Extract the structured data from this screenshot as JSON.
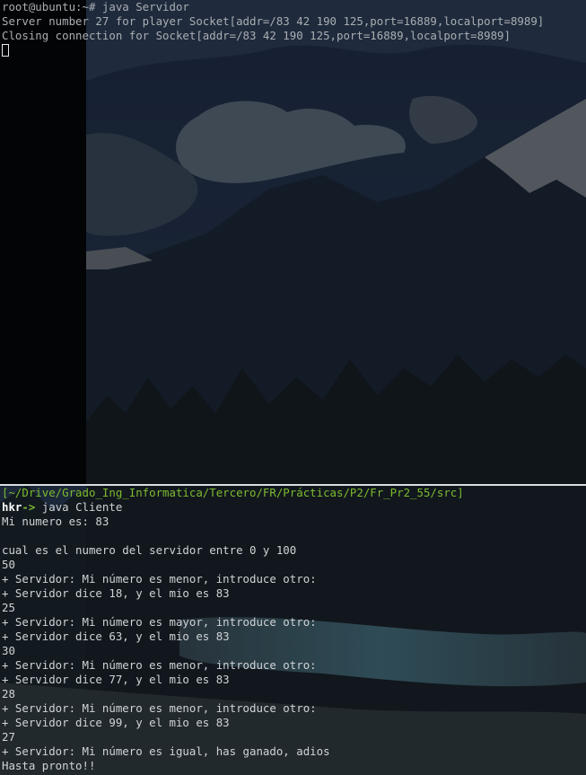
{
  "top_terminal": {
    "lines": [
      "root@ubuntu:~# java Servidor",
      "Server number 27 for player Socket[addr=/83 42 190 125,port=16889,localport=8989]",
      "Closing connection for Socket[addr=/83 42 190 125,port=16889,localport=8989]"
    ]
  },
  "bottom_terminal": {
    "path": "[~/Drive/Grado_Ing_Informatica/Tercero/FR/Prácticas/P2/Fr_Pr2_55/src]",
    "prompt_user": "hkr",
    "prompt_arrow": "->",
    "command": " java Cliente",
    "lines": [
      "Mi numero es: 83",
      "",
      "cual es el numero del servidor entre 0 y 100",
      "50",
      "+ Servidor: Mi número es menor, introduce otro:",
      "+ Servidor dice 18, y el mio es 83",
      "25",
      "+ Servidor: Mi número es mayor, introduce otro:",
      "+ Servidor dice 63, y el mio es 83",
      "30",
      "+ Servidor: Mi número es menor, introduce otro:",
      "+ Servidor dice 77, y el mio es 83",
      "28",
      "+ Servidor: Mi número es menor, introduce otro:",
      "+ Servidor dice 99, y el mio es 83",
      "27",
      "+ Servidor: Mi número es igual, has ganado, adios",
      "Hasta pronto!!"
    ]
  },
  "colors": {
    "path": "#7dbb2f",
    "text": "#cfd3d6",
    "divider": "#d8dde2"
  }
}
